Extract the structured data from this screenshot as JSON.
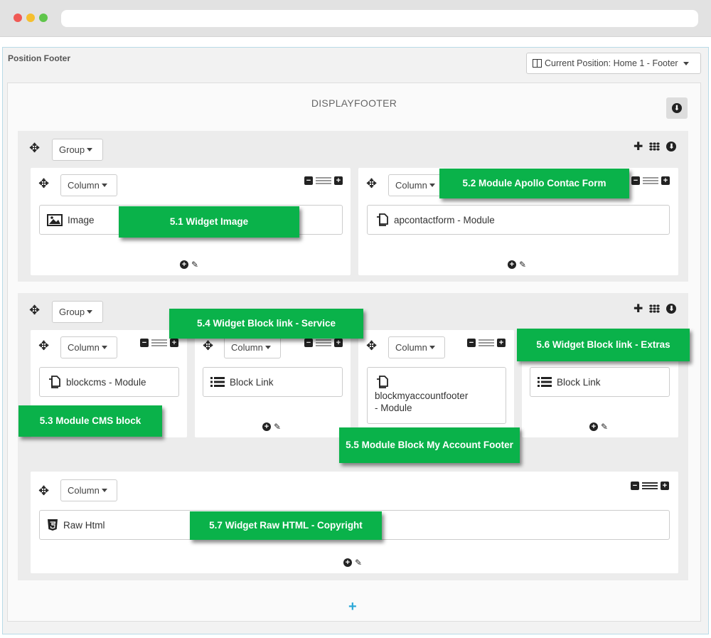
{
  "panel": {
    "title": "Position Footer",
    "position_button": "Current Position: Home 1 - Footer"
  },
  "hook": {
    "title": "DISPLAYFOOTER",
    "add_symbol": "+"
  },
  "groups": [
    {
      "select_label": "Group",
      "columns": [
        {
          "select_label": "Column",
          "widget": "Image"
        },
        {
          "select_label": "Column",
          "widget": "apcontactform  - Module"
        }
      ]
    },
    {
      "select_label": "Group",
      "columns": [
        {
          "select_label": "Column",
          "widget": "blockcms  - Module"
        },
        {
          "select_label": "Column",
          "widget": "Block Link"
        },
        {
          "select_label": "Column",
          "widget_line1": "blockmyaccountfooter",
          "widget_line2": "- Module"
        },
        {
          "widget": "Block Link"
        },
        {
          "select_label": "Column",
          "widget": "Raw Html"
        }
      ]
    }
  ],
  "annotations": {
    "a51": "5.1 Widget Image",
    "a52": "5.2 Module Apollo Contac Form",
    "a53": "5.3 Module CMS block",
    "a54": "5.4 Widget Block link - Service",
    "a55": "5.5 Module Block My Account Footer",
    "a56": "5.6 Widget Block link - Extras",
    "a57": "5.7 Widget Raw HTML - Copyright"
  },
  "colors": {
    "annotation_bg": "#0ab24a",
    "accent": "#2ca8d8"
  }
}
